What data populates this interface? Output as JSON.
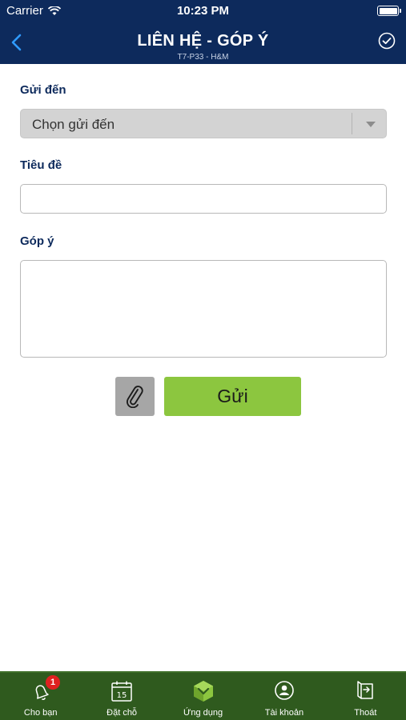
{
  "status_bar": {
    "carrier": "Carrier",
    "time": "10:23 PM"
  },
  "nav": {
    "title": "LIÊN HỆ - GÓP Ý",
    "subtitle": "T7-P33 - H&M"
  },
  "form": {
    "send_to_label": "Gửi đến",
    "send_to_value": "Chọn gửi đến",
    "subject_label": "Tiêu đề",
    "subject_value": "",
    "feedback_label": "Góp ý",
    "feedback_value": "",
    "send_button": "Gửi"
  },
  "tabbar": {
    "items": [
      {
        "label": "Cho bạn",
        "icon": "bell-icon",
        "badge": "1"
      },
      {
        "label": "Đặt chỗ",
        "icon": "calendar-icon",
        "day": "15"
      },
      {
        "label": "Ứng dụng",
        "icon": "apps-cube-icon"
      },
      {
        "label": "Tài khoản",
        "icon": "user-account-icon"
      },
      {
        "label": "Thoát",
        "icon": "logout-icon"
      }
    ]
  },
  "colors": {
    "nav_bg": "#0d2a5c",
    "tab_bg": "#2f5a1e",
    "send_btn": "#8cc63f",
    "label": "#0d2a5c",
    "badge": "#e02020"
  }
}
